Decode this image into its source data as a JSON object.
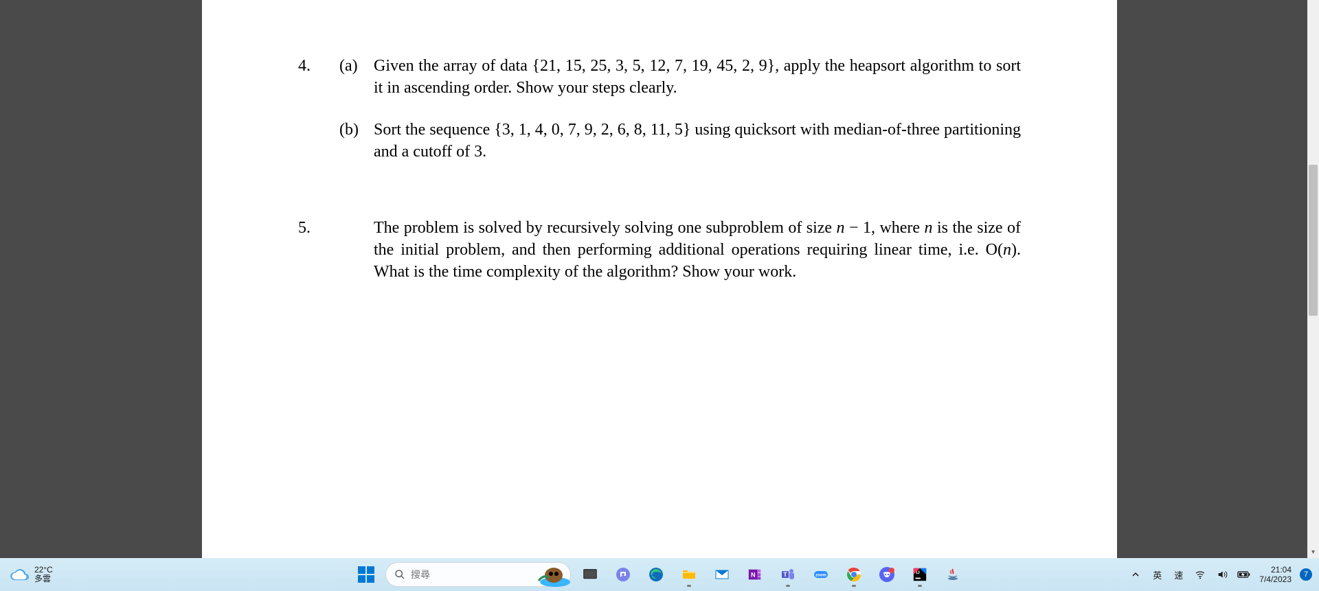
{
  "document": {
    "q4": {
      "num": "4.",
      "a": {
        "label": "(a)",
        "text": "Given the array of data {21, 15, 25, 3, 5, 12, 7, 19, 45, 2, 9}, apply the heapsort algorithm to sort it in ascending order. Show your steps clearly."
      },
      "b": {
        "label": "(b)",
        "text": "Sort the sequence {3, 1, 4, 0, 7, 9, 2, 6, 8, 11, 5} using quicksort with median-of-three partitioning and a cutoff of 3."
      }
    },
    "q5": {
      "num": "5.",
      "text_pre": "The problem is solved by recursively solving one subproblem of size ",
      "var1": "n",
      "text_mid1": " − 1, where ",
      "var2": "n",
      "text_mid2": " is the size of the initial problem, and then performing additional operations requiring linear time, i.e. O(",
      "var3": "n",
      "text_post": "). What is the time complexity of the algorithm? Show your work."
    }
  },
  "taskbar": {
    "weather": {
      "temp": "22°C",
      "cond": "多雲"
    },
    "search_placeholder": "搜尋",
    "ime_lang": "英",
    "ime_mode": "速",
    "time": "21:04",
    "date": "7/4/2023",
    "notif_count": "7"
  }
}
